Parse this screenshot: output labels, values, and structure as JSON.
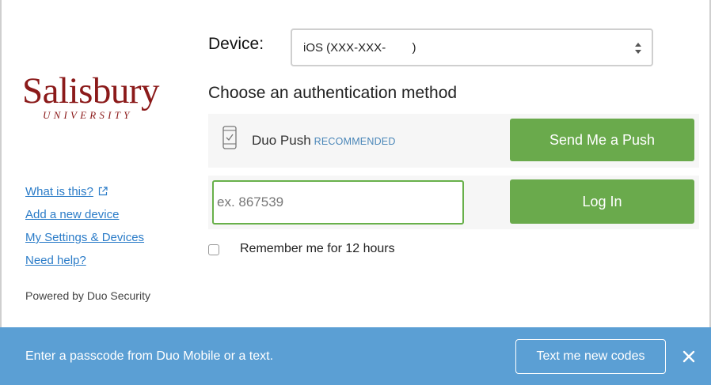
{
  "logo": {
    "name": "Salisbury",
    "subtitle": "UNIVERSITY",
    "color": "#8b1a1a"
  },
  "sidebar": {
    "links": [
      {
        "label": "What is this?",
        "icon": "external-link-icon"
      },
      {
        "label": "Add a new device"
      },
      {
        "label": "My Settings & Devices"
      },
      {
        "label": "Need help?"
      }
    ],
    "powered_by": "Powered by Duo Security"
  },
  "device": {
    "label": "Device:",
    "selected": "iOS (XXX-XXX-        )"
  },
  "auth": {
    "title": "Choose an authentication method",
    "push": {
      "icon": "phone-check-icon",
      "label": "Duo Push",
      "badge": "RECOMMENDED",
      "button": "Send Me a Push"
    },
    "passcode": {
      "placeholder": "ex. 867539",
      "value": "",
      "button": "Log In"
    },
    "remember": {
      "label": "Remember me for 12 hours",
      "checked": false
    }
  },
  "notice": {
    "message": "Enter a passcode from Duo Mobile or a text.",
    "button": "Text me new codes",
    "close_icon": "close-icon"
  },
  "colors": {
    "accent_green": "#6aaa4c",
    "banner_blue": "#5b9fd4",
    "link_blue": "#2b7cc8"
  }
}
